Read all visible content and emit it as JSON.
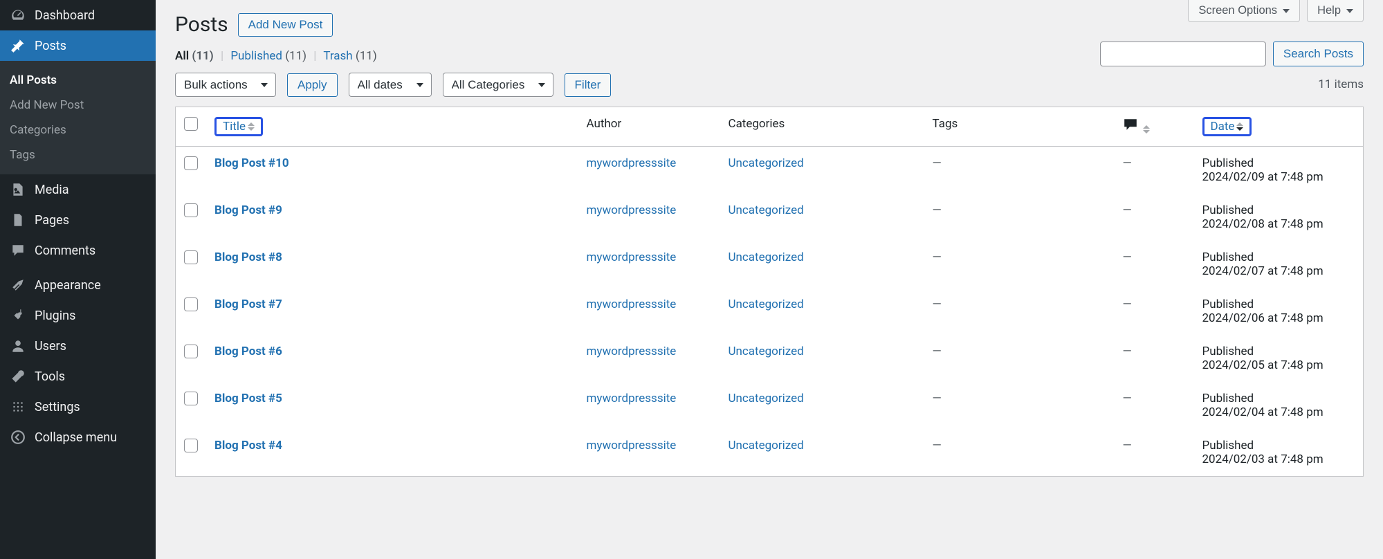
{
  "sidebar": {
    "items": [
      {
        "icon": "dashboard",
        "label": "Dashboard"
      },
      {
        "icon": "pin",
        "label": "Posts",
        "active": true,
        "submenu": [
          {
            "label": "All Posts",
            "current": true
          },
          {
            "label": "Add New Post"
          },
          {
            "label": "Categories"
          },
          {
            "label": "Tags"
          }
        ]
      },
      {
        "icon": "media",
        "label": "Media"
      },
      {
        "icon": "pages",
        "label": "Pages"
      },
      {
        "icon": "comments",
        "label": "Comments"
      },
      {
        "icon": "appearance",
        "label": "Appearance"
      },
      {
        "icon": "plugins",
        "label": "Plugins"
      },
      {
        "icon": "users",
        "label": "Users"
      },
      {
        "icon": "tools",
        "label": "Tools"
      },
      {
        "icon": "settings",
        "label": "Settings"
      },
      {
        "icon": "collapse",
        "label": "Collapse menu"
      }
    ]
  },
  "topTabs": {
    "screenOptions": "Screen Options",
    "help": "Help"
  },
  "header": {
    "title": "Posts",
    "addNew": "Add New Post"
  },
  "filters": {
    "views": [
      {
        "label": "All",
        "count": "(11)",
        "current": true
      },
      {
        "label": "Published",
        "count": "(11)"
      },
      {
        "label": "Trash",
        "count": "(11)"
      }
    ],
    "bulkActions": "Bulk actions",
    "apply": "Apply",
    "allDates": "All dates",
    "allCategories": "All Categories",
    "filter": "Filter",
    "searchBtn": "Search Posts",
    "itemsCount": "11 items"
  },
  "table": {
    "columns": {
      "title": "Title",
      "author": "Author",
      "categories": "Categories",
      "tags": "Tags",
      "date": "Date"
    },
    "rows": [
      {
        "title": "Blog Post #10",
        "author": "mywordpresssite",
        "category": "Uncategorized",
        "tags": "—",
        "comments": "—",
        "status": "Published",
        "date": "2024/02/09 at 7:48 pm"
      },
      {
        "title": "Blog Post #9",
        "author": "mywordpresssite",
        "category": "Uncategorized",
        "tags": "—",
        "comments": "—",
        "status": "Published",
        "date": "2024/02/08 at 7:48 pm"
      },
      {
        "title": "Blog Post #8",
        "author": "mywordpresssite",
        "category": "Uncategorized",
        "tags": "—",
        "comments": "—",
        "status": "Published",
        "date": "2024/02/07 at 7:48 pm"
      },
      {
        "title": "Blog Post #7",
        "author": "mywordpresssite",
        "category": "Uncategorized",
        "tags": "—",
        "comments": "—",
        "status": "Published",
        "date": "2024/02/06 at 7:48 pm"
      },
      {
        "title": "Blog Post #6",
        "author": "mywordpresssite",
        "category": "Uncategorized",
        "tags": "—",
        "comments": "—",
        "status": "Published",
        "date": "2024/02/05 at 7:48 pm"
      },
      {
        "title": "Blog Post #5",
        "author": "mywordpresssite",
        "category": "Uncategorized",
        "tags": "—",
        "comments": "—",
        "status": "Published",
        "date": "2024/02/04 at 7:48 pm"
      },
      {
        "title": "Blog Post #4",
        "author": "mywordpresssite",
        "category": "Uncategorized",
        "tags": "—",
        "comments": "—",
        "status": "Published",
        "date": "2024/02/03 at 7:48 pm"
      }
    ]
  }
}
